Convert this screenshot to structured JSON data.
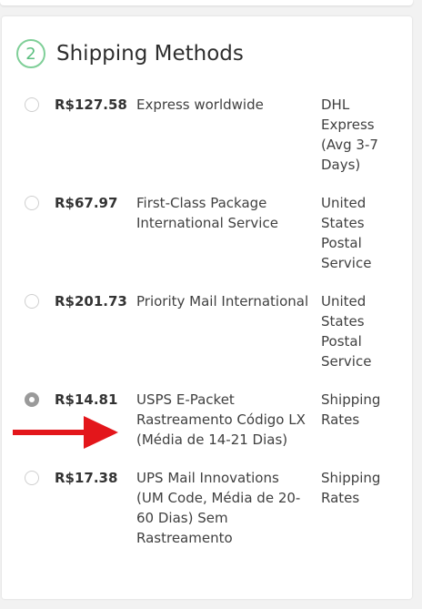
{
  "section": {
    "step_number": "2",
    "title": "Shipping Methods"
  },
  "methods": [
    {
      "price": "R$127.58",
      "description": "Express worldwide",
      "carrier": "DHL Express (Avg 3-7 Days)",
      "selected": false
    },
    {
      "price": "R$67.97",
      "description": "First-Class Package International Service",
      "carrier": "United States Postal Service",
      "selected": false
    },
    {
      "price": "R$201.73",
      "description": "Priority Mail International",
      "carrier": "United States Postal Service",
      "selected": false
    },
    {
      "price": "R$14.81",
      "description": "USPS E-Packet Rastreamento Código LX (Média de 14-21 Dias)",
      "carrier": "Shipping Rates",
      "selected": true
    },
    {
      "price": "R$17.38",
      "description": "UPS Mail Innovations (UM Code, Média de 20-60 Dias) Sem Rastreamento",
      "carrier": "Shipping Rates",
      "selected": false
    }
  ],
  "colors": {
    "accent_green": "#5cbf80",
    "annotation_arrow": "#e3161b"
  },
  "icons": {
    "annotation": "red-arrow-icon"
  }
}
